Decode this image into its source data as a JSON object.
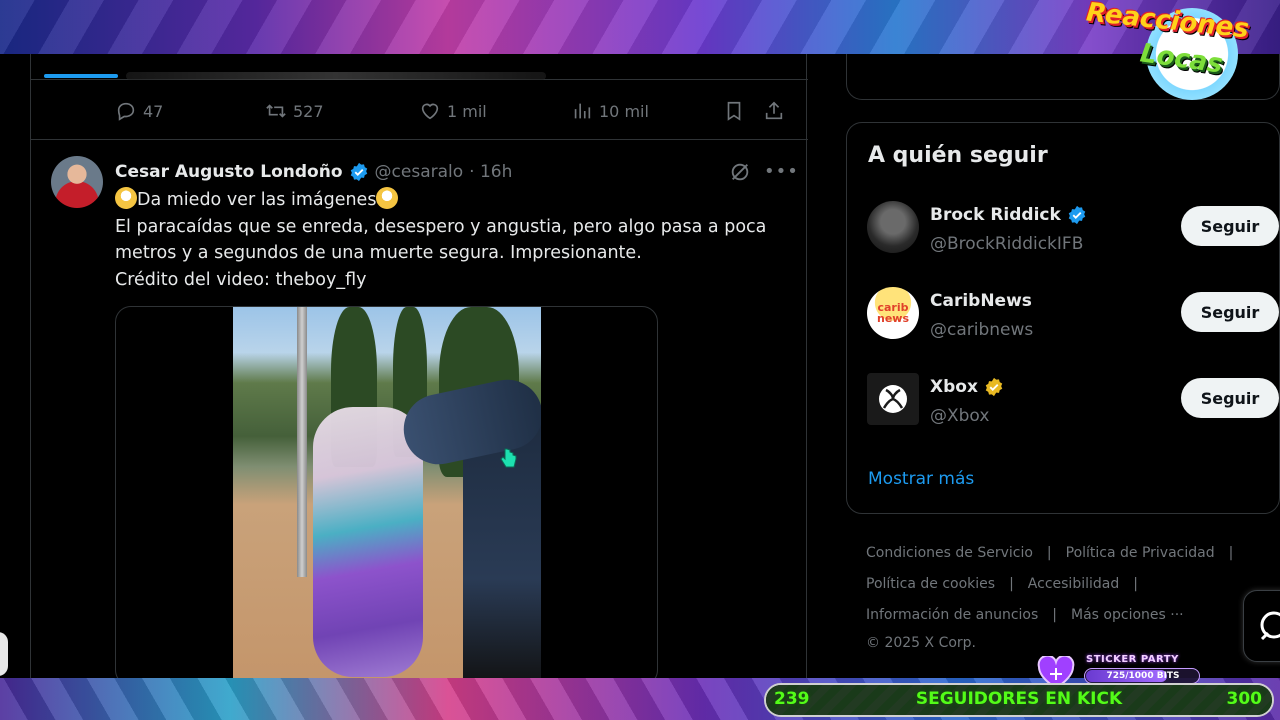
{
  "overlay": {
    "logo_line1": "Reacciones",
    "logo_line2": "Locas",
    "sticker_title": "STICKER PARTY",
    "sticker_progress": "725/1000 BITS",
    "sticker_fraction": 0.725,
    "kick_start": "239",
    "kick_label": "SEGUIDORES EN KICK",
    "kick_end": "300"
  },
  "prev_tweet_actions": {
    "replies": "47",
    "retweets": "527",
    "likes": "1 mil",
    "views": "10 mil"
  },
  "tweet": {
    "name": "Cesar Augusto Londoño",
    "handle": "@cesaralo",
    "time": "· 16h",
    "line1": "Da miedo ver las imágenes",
    "line2": "El paracaídas que se enreda, desespero y angustia, pero algo pasa a poca",
    "line3": "metros y a segundos de una muerte segura. Impresionante.",
    "line4": "Crédito del video: theboy_fly"
  },
  "who_to_follow": {
    "title": "A quién seguir",
    "accounts": [
      {
        "name": "Brock Riddick",
        "handle": "@BrockRiddickIFB",
        "button": "Seguir",
        "badge": "blue"
      },
      {
        "name": "CaribNews",
        "handle": "@caribnews",
        "button": "Seguir",
        "badge": "none",
        "avatar_text": "carib news"
      },
      {
        "name": "Xbox",
        "handle": "@Xbox",
        "button": "Seguir",
        "badge": "gold"
      }
    ],
    "show_more": "Mostrar más"
  },
  "footer": {
    "terms": "Condiciones de Servicio",
    "privacy": "Política de Privacidad",
    "cookies": "Política de cookies",
    "accessibility": "Accesibilidad",
    "ads": "Información de anuncios",
    "more": "Más opciones ···",
    "copyright": "© 2025 X Corp."
  },
  "colors": {
    "accent": "#1d9bf0",
    "kick_green": "#53fc18",
    "verified_gold": "#e8b923"
  }
}
